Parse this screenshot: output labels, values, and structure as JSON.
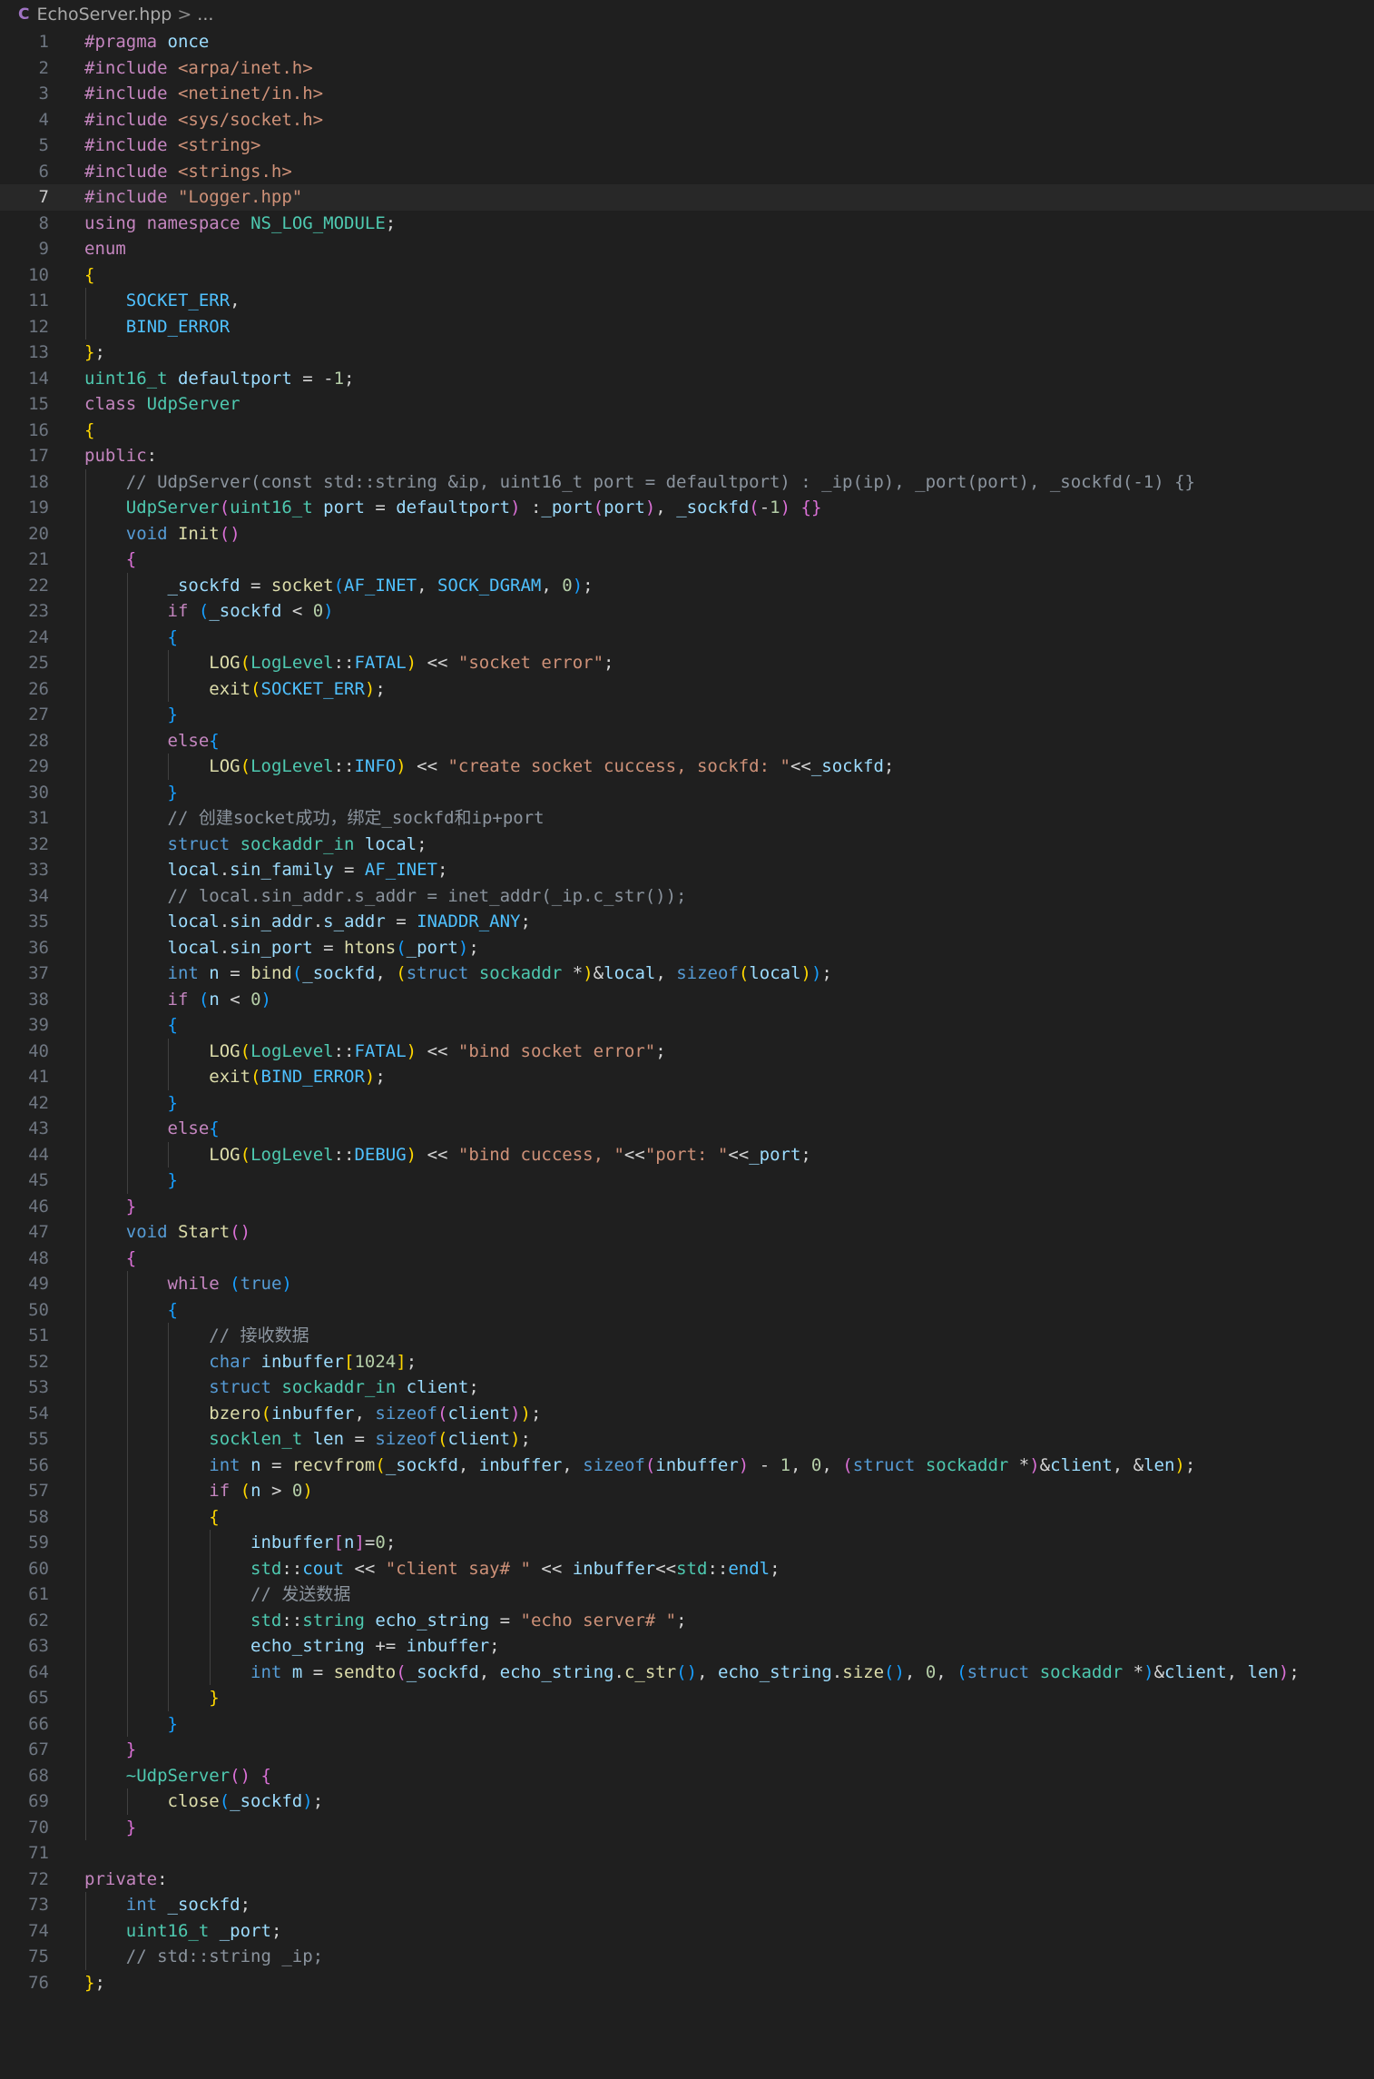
{
  "breadcrumb": {
    "file_icon": "C",
    "file_name": "EchoServer.hpp",
    "separator": ">",
    "trail": "..."
  },
  "editor": {
    "current_line": 7,
    "lines": [
      "#pragma once",
      "#include <arpa/inet.h>",
      "#include <netinet/in.h>",
      "#include <sys/socket.h>",
      "#include <string>",
      "#include <strings.h>",
      "#include \"Logger.hpp\"",
      "using namespace NS_LOG_MODULE;",
      "enum",
      "{",
      "    SOCKET_ERR,",
      "    BIND_ERROR",
      "};",
      "uint16_t defaultport = -1;",
      "class UdpServer",
      "{",
      "public:",
      "    // UdpServer(const std::string &ip, uint16_t port = defaultport) : _ip(ip), _port(port), _sockfd(-1) {}",
      "    UdpServer(uint16_t port = defaultport) :_port(port), _sockfd(-1) {}",
      "    void Init()",
      "    {",
      "        _sockfd = socket(AF_INET, SOCK_DGRAM, 0);",
      "        if (_sockfd < 0)",
      "        {",
      "            LOG(LogLevel::FATAL) << \"socket error\";",
      "            exit(SOCKET_ERR);",
      "        }",
      "        else{",
      "            LOG(LogLevel::INFO) << \"create socket cuccess, sockfd: \"<<_sockfd;",
      "        }",
      "        // 创建socket成功，绑定_sockfd和ip+port",
      "        struct sockaddr_in local;",
      "        local.sin_family = AF_INET;",
      "        // local.sin_addr.s_addr = inet_addr(_ip.c_str());",
      "        local.sin_addr.s_addr = INADDR_ANY;",
      "        local.sin_port = htons(_port);",
      "        int n = bind(_sockfd, (struct sockaddr *)&local, sizeof(local));",
      "        if (n < 0)",
      "        {",
      "            LOG(LogLevel::FATAL) << \"bind socket error\";",
      "            exit(BIND_ERROR);",
      "        }",
      "        else{",
      "            LOG(LogLevel::DEBUG) << \"bind cuccess, \"<<\"port: \"<<_port;",
      "        }",
      "    }",
      "    void Start()",
      "    {",
      "        while (true)",
      "        {",
      "            // 接收数据",
      "            char inbuffer[1024];",
      "            struct sockaddr_in client;",
      "            bzero(inbuffer, sizeof(client));",
      "            socklen_t len = sizeof(client);",
      "            int n = recvfrom(_sockfd, inbuffer, sizeof(inbuffer) - 1, 0, (struct sockaddr *)&client, &len);",
      "            if (n > 0)",
      "            {",
      "                inbuffer[n]=0;",
      "                std::cout << \"client say# \" << inbuffer<<std::endl;",
      "                // 发送数据",
      "                std::string echo_string = \"echo server# \";",
      "                echo_string += inbuffer;",
      "                int m = sendto(_sockfd, echo_string.c_str(), echo_string.size(), 0, (struct sockaddr *)&client, len);",
      "            }",
      "        }",
      "    }",
      "    ~UdpServer() {",
      "        close(_sockfd);",
      "    }",
      "",
      "private:",
      "    int _sockfd;",
      "    uint16_t _port;",
      "    // std::string _ip;",
      "};"
    ]
  },
  "colors": {
    "background": "#1f1f1f",
    "current_line": "#282828",
    "line_number": "#6e7681",
    "keyword": "#c586c0",
    "type": "#4ec9b0",
    "function": "#dcdcaa",
    "string": "#ce9178",
    "comment": "#8b949e",
    "number": "#b5cea8",
    "macro": "#4fc1ff",
    "bracket_gold": "#ffd700",
    "bracket_purple": "#da70d6",
    "bracket_blue": "#179fff"
  }
}
